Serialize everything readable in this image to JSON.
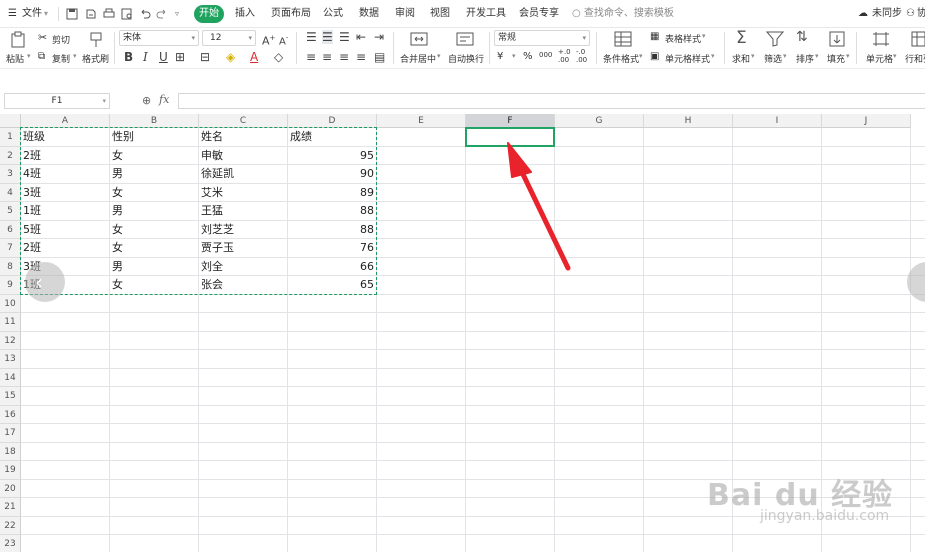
{
  "menu": {
    "file_label": "文件",
    "tabs": [
      "开始",
      "插入",
      "页面布局",
      "公式",
      "数据",
      "审阅",
      "视图",
      "开发工具",
      "会员专享"
    ],
    "search_placeholder": "查找命令、搜索模板",
    "sync_label": "未同步",
    "collab_label": "协"
  },
  "ribbon": {
    "paste": "粘贴",
    "cut": "剪切",
    "copy": "复制",
    "format_painter": "格式刷",
    "font_name": "宋体",
    "font_size": "12",
    "merge_center": "合并居中",
    "wrap_text": "自动换行",
    "number_format": "常规",
    "currency": "¥",
    "percent": "%",
    "thousands": "000",
    "conditional_format": "条件格式",
    "table_style": "表格样式",
    "cell_style": "单元格样式",
    "sum": "求和",
    "filter": "筛选",
    "sort": "排序",
    "fill": "填充",
    "cell": "单元格",
    "row_col": "行和列"
  },
  "formula_bar": {
    "name_box": "F1",
    "fx": "fx",
    "value": ""
  },
  "sheet": {
    "columns": [
      "A",
      "B",
      "C",
      "D",
      "E",
      "F",
      "G",
      "H",
      "I",
      "J"
    ],
    "selected_column": "F",
    "rows": [
      "1",
      "2",
      "3",
      "4",
      "5",
      "6",
      "7",
      "8",
      "9",
      "10",
      "11",
      "12",
      "13",
      "14",
      "15",
      "16",
      "17",
      "18",
      "19",
      "20",
      "21",
      "22",
      "23"
    ],
    "headers": [
      "班级",
      "性别",
      "姓名",
      "成绩"
    ],
    "data": [
      [
        "2班",
        "女",
        "申敏",
        "95"
      ],
      [
        "4班",
        "男",
        "徐延凯",
        "90"
      ],
      [
        "3班",
        "女",
        "艾米",
        "89"
      ],
      [
        "1班",
        "男",
        "王猛",
        "88"
      ],
      [
        "5班",
        "女",
        "刘芝芝",
        "88"
      ],
      [
        "2班",
        "女",
        "贾子玉",
        "76"
      ],
      [
        "3班",
        "男",
        "刘全",
        "66"
      ],
      [
        "1班",
        "女",
        "张会",
        "65"
      ]
    ]
  },
  "watermark": {
    "brand": "Bai du 经验",
    "url": "jingyan.baidu.com"
  },
  "colors": {
    "accent_green": "#1fa35f",
    "annotation_arrow": "#e8232b"
  }
}
